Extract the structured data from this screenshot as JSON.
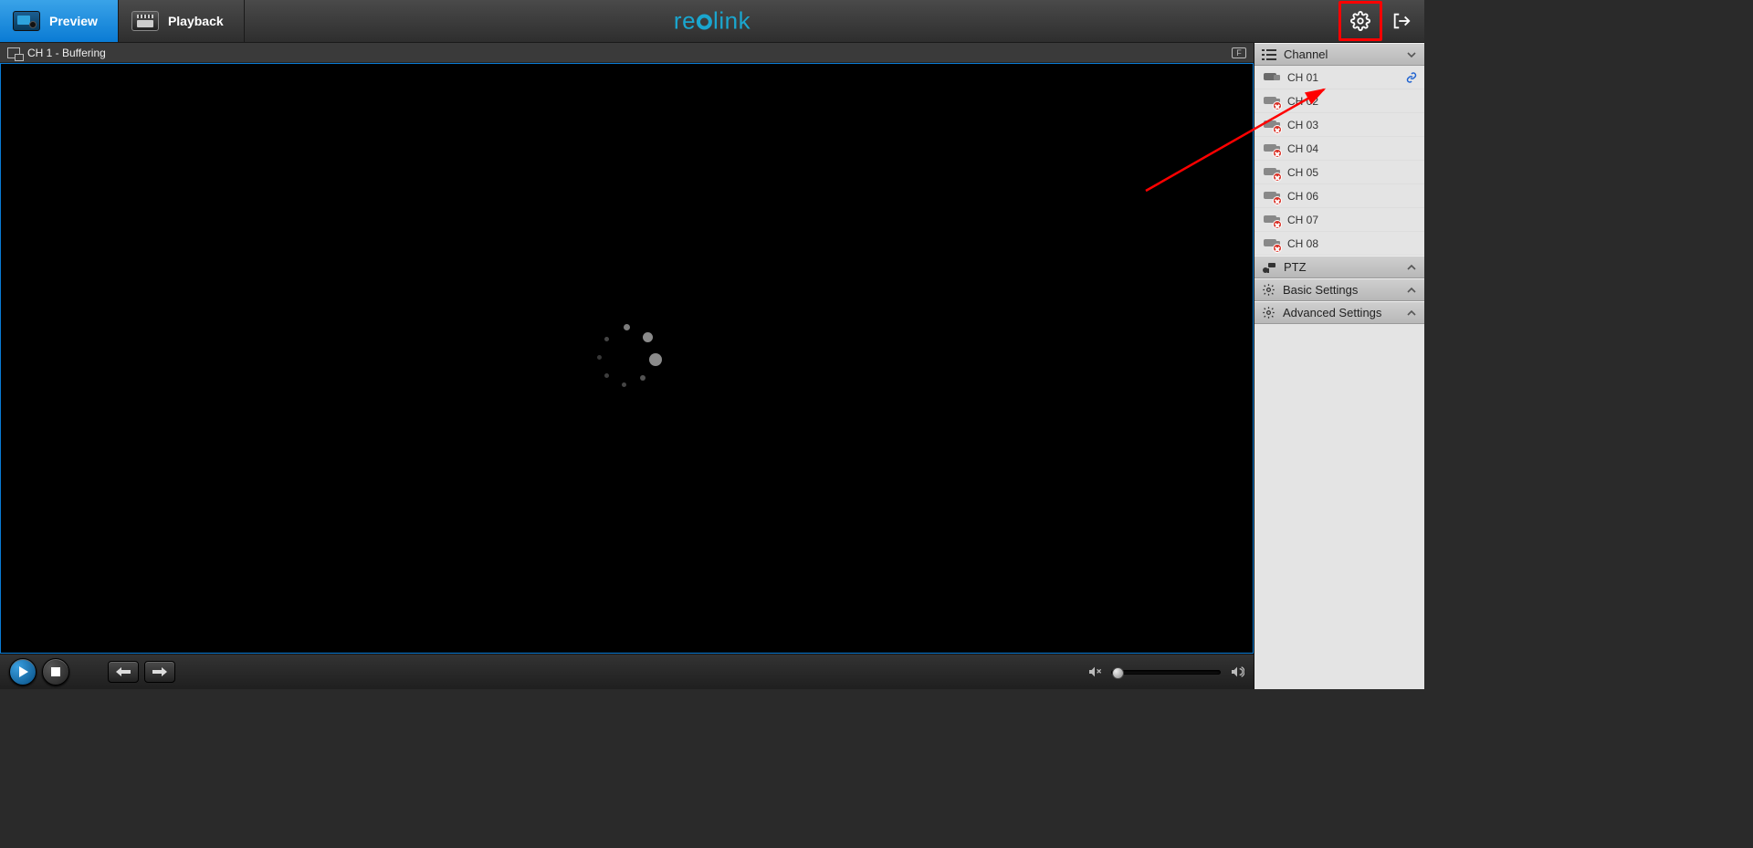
{
  "topbar": {
    "preview_label": "Preview",
    "playback_label": "Playback",
    "brand_pre": "re",
    "brand_post": "link"
  },
  "status": {
    "text": "CH 1 - Buffering",
    "overlay_badge": "F"
  },
  "sidebar": {
    "channel_header": "Channel",
    "ptz_header": "PTZ",
    "basic_header": "Basic Settings",
    "advanced_header": "Advanced Settings",
    "channels": [
      {
        "label": "CH 01",
        "connected": true
      },
      {
        "label": "CH 02",
        "connected": false
      },
      {
        "label": "CH 03",
        "connected": false
      },
      {
        "label": "CH 04",
        "connected": false
      },
      {
        "label": "CH 05",
        "connected": false
      },
      {
        "label": "CH 06",
        "connected": false
      },
      {
        "label": "CH 07",
        "connected": false
      },
      {
        "label": "CH 08",
        "connected": false
      }
    ]
  },
  "colors": {
    "accent": "#0a7bd4",
    "brand": "#1aa6cf",
    "highlight": "#ff0000"
  }
}
